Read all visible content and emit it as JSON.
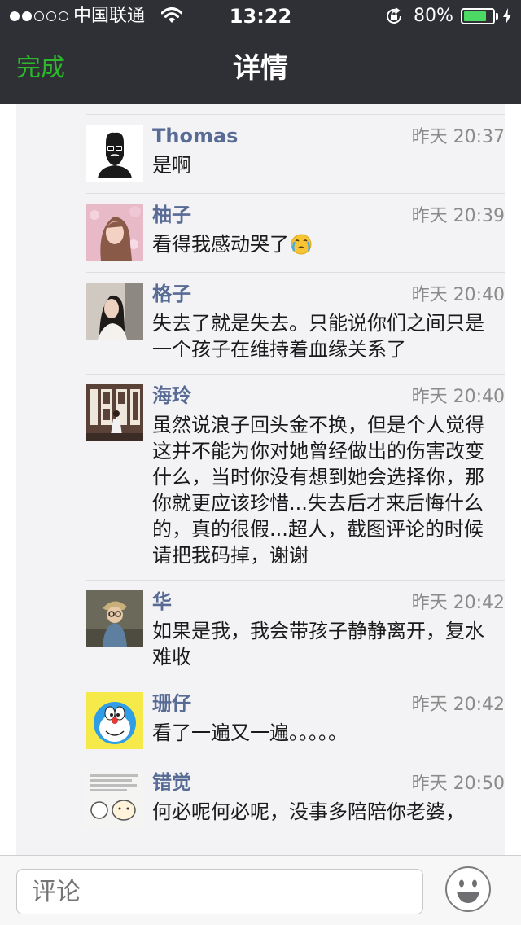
{
  "status_bar": {
    "carrier": "中国联通",
    "time": "13:22",
    "battery": "80%",
    "battery_level": 0.8,
    "signal_strength": 2,
    "signal_total": 5
  },
  "nav": {
    "left_button": "完成",
    "title": "详情"
  },
  "comments": [
    {
      "name": "Thomas",
      "time": "昨天 20:37",
      "text": "是啊",
      "avatar": "avatar-thomas"
    },
    {
      "name": "柚子",
      "time": "昨天 20:39",
      "text": "看得我感动哭了",
      "emoji": "crying-face-emoji",
      "avatar": "avatar-youzi"
    },
    {
      "name": "格子",
      "time": "昨天 20:40",
      "text": "失去了就是失去。只能说你们之间只是一个孩子在维持着血缘关系了",
      "avatar": "avatar-gezi"
    },
    {
      "name": "海玲",
      "time": "昨天 20:40",
      "text": "虽然说浪子回头金不换，但是个人觉得这并不能为你对她曾经做出的伤害改变什么，当时你没有想到她会选择你，那你就更应该珍惜...失去后才来后悔什么的，真的很假...超人，截图评论的时候请把我码掉，谢谢",
      "avatar": "avatar-hailing"
    },
    {
      "name": "华",
      "time": "昨天 20:42",
      "text": "如果是我，我会带孩子静静离开，复水难收",
      "avatar": "avatar-hua"
    },
    {
      "name": "珊仔",
      "time": "昨天 20:42",
      "text": "看了一遍又一遍。。。。。",
      "avatar": "avatar-shanzai"
    },
    {
      "name": "错觉",
      "time": "昨天 20:50",
      "text": "何必呢何必呢，没事多陪陪你老婆，",
      "avatar": "avatar-cuojue"
    }
  ],
  "input": {
    "placeholder": "评论"
  },
  "colors": {
    "nav_bg": "#2e3035",
    "accent_green": "#2bb82b",
    "name_blue": "#586b95",
    "time_gray": "#8b8b8b",
    "panel_bg": "#f3f3f5",
    "battery_green": "#4cd964"
  }
}
